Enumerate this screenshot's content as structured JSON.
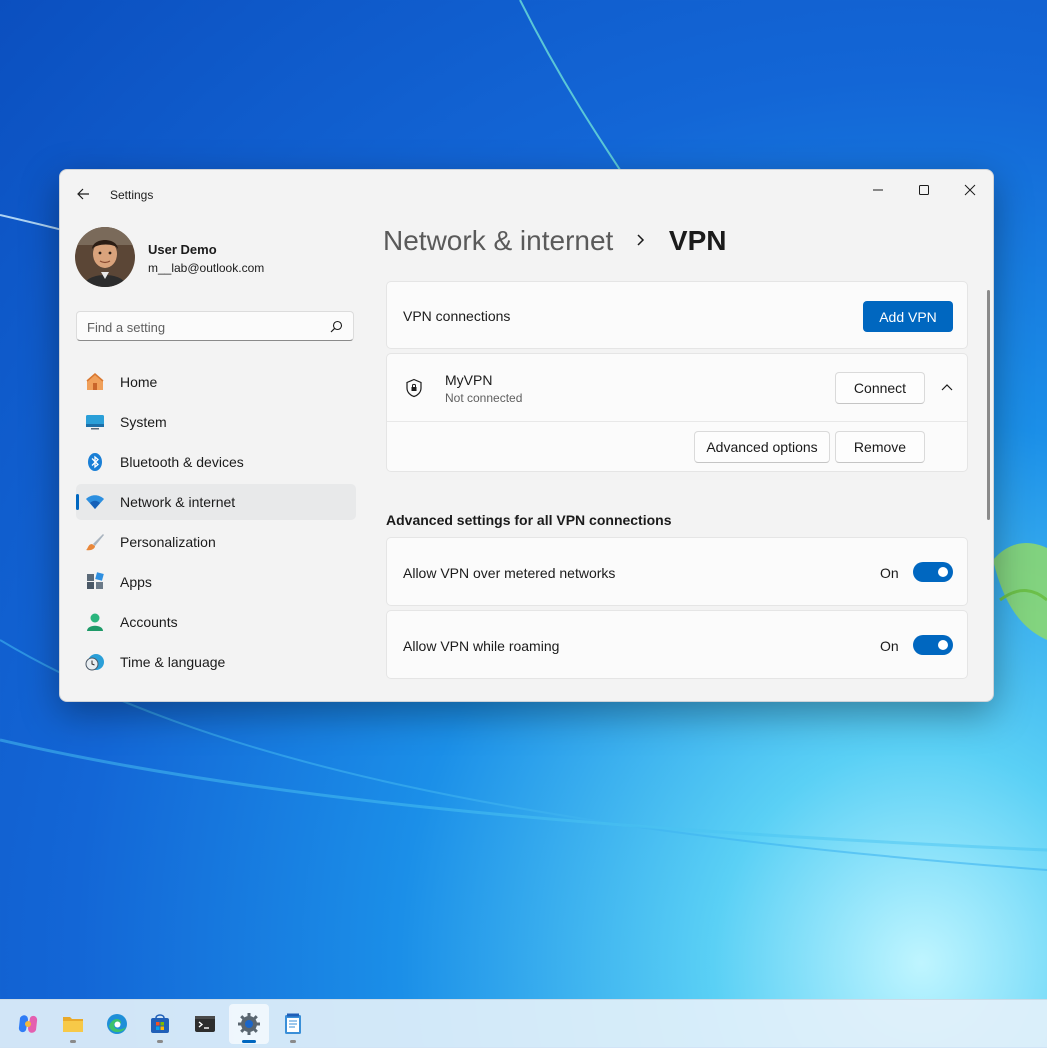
{
  "window": {
    "app_title": "Settings",
    "user": {
      "name": "User Demo",
      "email": "m__lab@outlook.com"
    },
    "search": {
      "placeholder": "Find a setting"
    }
  },
  "sidebar": {
    "items": [
      {
        "label": "Home",
        "icon": "home-icon",
        "active": false
      },
      {
        "label": "System",
        "icon": "system-icon",
        "active": false
      },
      {
        "label": "Bluetooth & devices",
        "icon": "bluetooth-icon",
        "active": false
      },
      {
        "label": "Network & internet",
        "icon": "wifi-icon",
        "active": true
      },
      {
        "label": "Personalization",
        "icon": "brush-icon",
        "active": false
      },
      {
        "label": "Apps",
        "icon": "apps-icon",
        "active": false
      },
      {
        "label": "Accounts",
        "icon": "accounts-icon",
        "active": false
      },
      {
        "label": "Time & language",
        "icon": "clock-globe-icon",
        "active": false
      }
    ]
  },
  "main": {
    "breadcrumb": {
      "parent": "Network & internet",
      "current": "VPN"
    },
    "vpn_connections": {
      "label": "VPN connections",
      "add_button": "Add VPN"
    },
    "vpn": {
      "name": "MyVPN",
      "status": "Not connected",
      "connect_button": "Connect",
      "advanced_button": "Advanced options",
      "remove_button": "Remove"
    },
    "advanced": {
      "title": "Advanced settings for all VPN connections",
      "settings": [
        {
          "label": "Allow VPN over metered networks",
          "state": "On"
        },
        {
          "label": "Allow VPN while roaming",
          "state": "On"
        }
      ]
    }
  },
  "taskbar": {
    "apps": [
      "copilot-icon",
      "file-explorer-icon",
      "edge-icon",
      "store-icon",
      "terminal-icon",
      "settings-icon",
      "notepad-icon"
    ],
    "active": "settings-icon"
  },
  "colors": {
    "accent": "#0067c0",
    "window_bg": "#f3f3f3",
    "card_bg": "#fbfbfb"
  }
}
